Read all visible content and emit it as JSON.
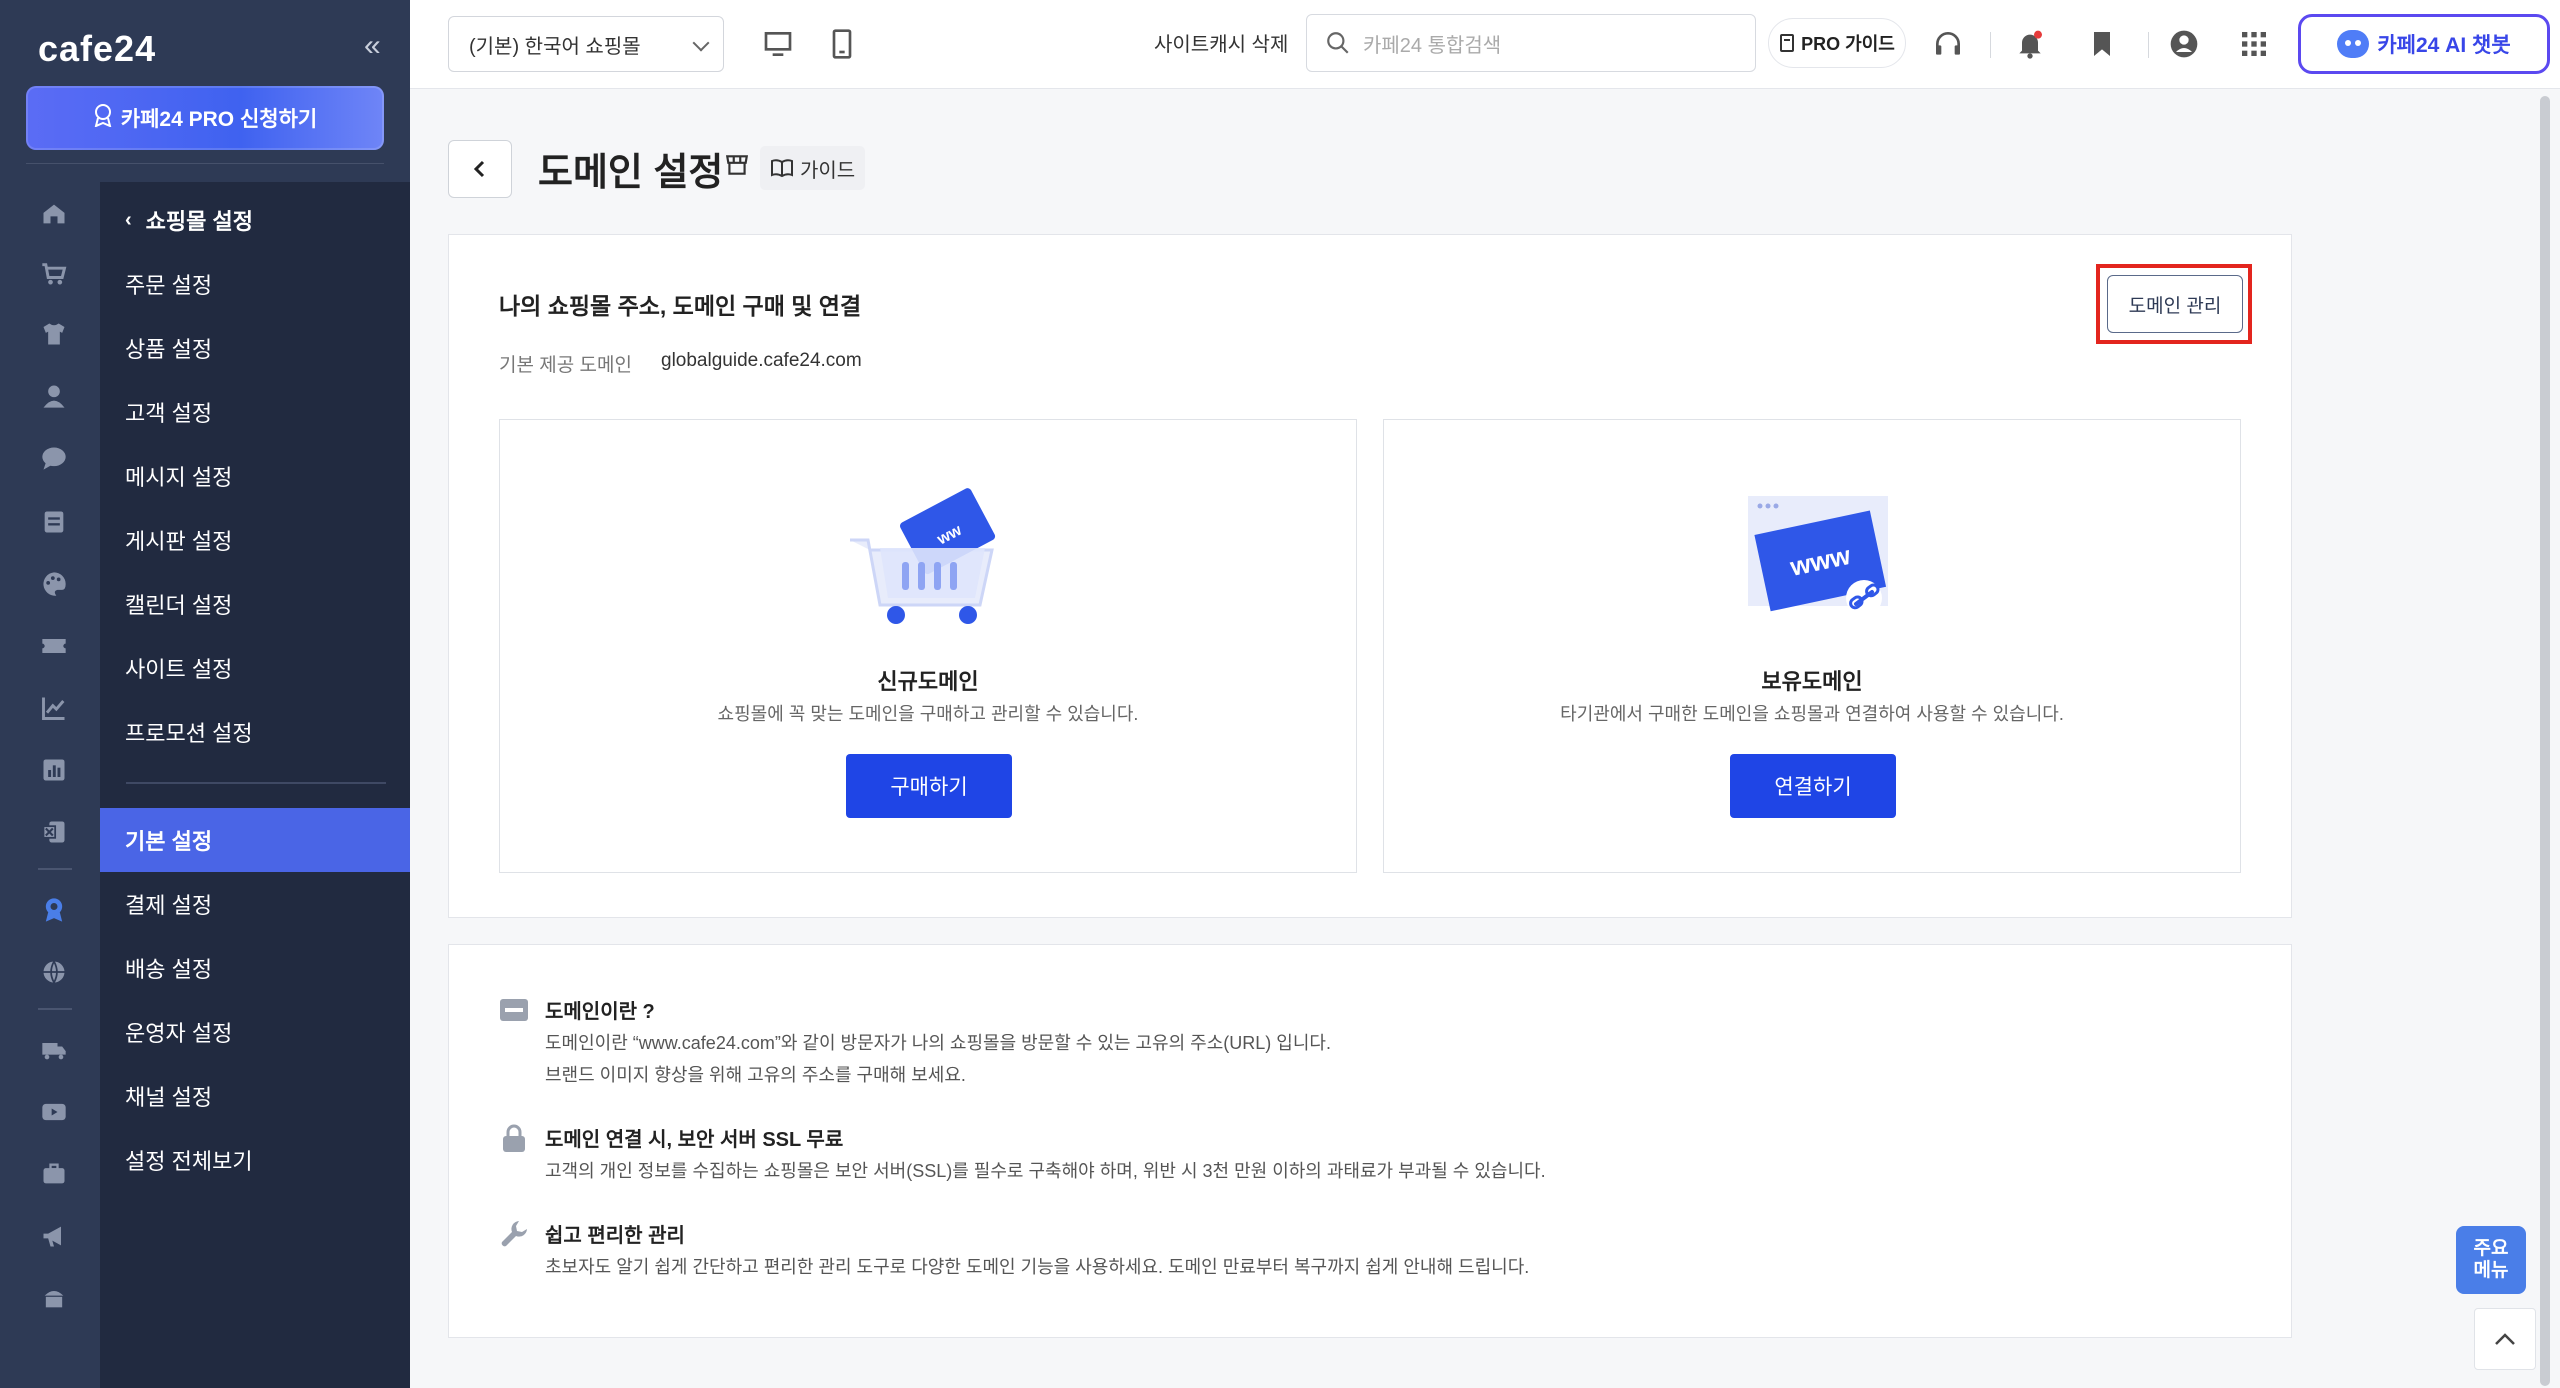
{
  "sidebar": {
    "logo": "cafe24",
    "collapse_icon": "double-chevron-left-icon",
    "pro_button_label": "카페24 PRO 신청하기",
    "rail_icons": [
      "home-icon",
      "cart-icon",
      "shirt-icon",
      "user-icon",
      "chat-icon",
      "board-icon",
      "palette-icon",
      "coupon-icon",
      "chart-line-icon",
      "stats-icon",
      "excel-icon",
      "award-icon",
      "globe-icon",
      "truck-icon",
      "video-icon",
      "briefcase-icon",
      "megaphone-icon",
      "cafe-icon"
    ],
    "menu_back_label": "쇼핑몰 설정",
    "menu_items": [
      {
        "label": "주문 설정"
      },
      {
        "label": "상품 설정"
      },
      {
        "label": "고객 설정"
      },
      {
        "label": "메시지 설정"
      },
      {
        "label": "게시판 설정"
      },
      {
        "label": "캘린더 설정"
      },
      {
        "label": "사이트 설정"
      },
      {
        "label": "프로모션 설정"
      }
    ],
    "menu_items_2": [
      {
        "label": "기본 설정",
        "active": true
      },
      {
        "label": "결제 설정"
      },
      {
        "label": "배송 설정"
      },
      {
        "label": "운영자 설정"
      },
      {
        "label": "채널 설정"
      },
      {
        "label": "설정 전체보기"
      }
    ]
  },
  "header": {
    "shop_select_value": "(기본) 한국어 쇼핑몰",
    "cache_delete_label": "사이트캐시 삭제",
    "search_placeholder": "카페24 통합검색",
    "pro_guide_label": "PRO 가이드",
    "ai_chat_label": "카페24 AI 챗봇"
  },
  "page": {
    "title": "도메인 설정",
    "guide_label": "가이드",
    "section_title": "나의 쇼핑몰 주소, 도메인 구매 및 연결",
    "default_domain_label": "기본 제공 도메인",
    "default_domain_value": "globalguide.cafe24.com",
    "manage_button_label": "도메인 관리",
    "new_domain": {
      "title": "신규도메인",
      "desc": "쇼핑몰에 꼭 맞는 도메인을 구매하고 관리할 수 있습니다.",
      "button": "구매하기"
    },
    "own_domain": {
      "title": "보유도메인",
      "desc": "타기관에서 구매한 도메인을 쇼핑몰과 연결하여 사용할 수 있습니다.",
      "button": "연결하기",
      "illust_text": "www"
    }
  },
  "info": [
    {
      "icon": "card-icon",
      "title": "도메인이란 ?",
      "lines": [
        "도메인이란 “www.cafe24.com”와 같이 방문자가 나의 쇼핑몰을 방문할 수 있는 고유의 주소(URL) 입니다.",
        "브랜드 이미지 향상을 위해 고유의 주소를 구매해 보세요."
      ]
    },
    {
      "icon": "lock-icon",
      "title": "도메인 연결 시, 보안 서버 SSL 무료",
      "lines": [
        "고객의 개인 정보를 수집하는 쇼핑몰은 보안 서버(SSL)를 필수로 구축해야 하며, 위반 시 3천 만원 이하의 과태료가 부과될 수 있습니다."
      ]
    },
    {
      "icon": "wrench-icon",
      "title": "쉽고 편리한 관리",
      "lines": [
        "초보자도 알기 쉽게 간단하고 편리한 관리 도구로 다양한 도메인 기능을 사용하세요. 도메인 만료부터 복구까지 쉽게 안내해 드립니다."
      ]
    }
  ],
  "floaters": {
    "quick_menu_line1": "주요",
    "quick_menu_line2": "메뉴"
  },
  "colors": {
    "sidebar_bg": "#2e3a55",
    "menu_bg": "#212a40",
    "active_menu": "#4a65e6",
    "primary": "#1f45e6",
    "highlight": "#e3251e",
    "ai_border": "#5b49f0"
  }
}
